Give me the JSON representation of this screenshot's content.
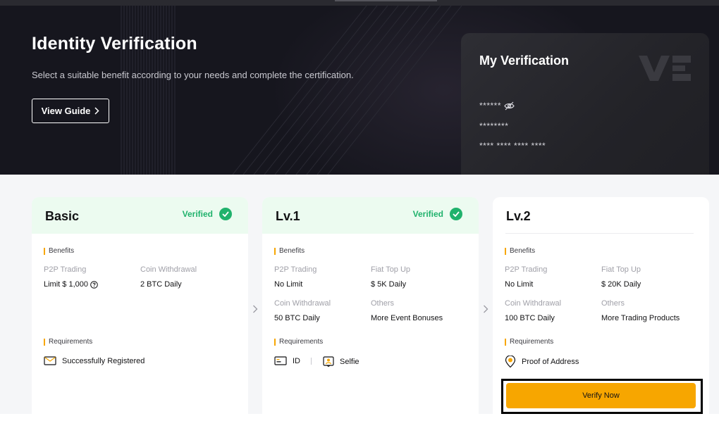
{
  "hero": {
    "title": "Identity Verification",
    "subtitle": "Select a suitable benefit according to your needs and complete the certification.",
    "guide_button": "View Guide"
  },
  "my_verification": {
    "title": "My Verification",
    "masked_name": "******",
    "masked_id": "********",
    "masked_number": "**** **** **** ****"
  },
  "cards": {
    "basic": {
      "level": "Basic",
      "status": "Verified",
      "benefits_label": "Benefits",
      "b1_key": "P2P Trading",
      "b1_val": "Limit $ 1,000",
      "b2_key": "Coin Withdrawal",
      "b2_val": "2 BTC Daily",
      "requirements_label": "Requirements",
      "req1": "Successfully Registered"
    },
    "lv1": {
      "level": "Lv.1",
      "status": "Verified",
      "benefits_label": "Benefits",
      "b1_key": "P2P Trading",
      "b1_val": "No Limit",
      "b2_key": "Fiat Top Up",
      "b2_val": "$ 5K Daily",
      "b3_key": "Coin Withdrawal",
      "b3_val": "50 BTC Daily",
      "b4_key": "Others",
      "b4_val": "More Event Bonuses",
      "requirements_label": "Requirements",
      "req1": "ID",
      "req2": "Selfie"
    },
    "lv2": {
      "level": "Lv.2",
      "benefits_label": "Benefits",
      "b1_key": "P2P Trading",
      "b1_val": "No Limit",
      "b2_key": "Fiat Top Up",
      "b2_val": "$ 20K Daily",
      "b3_key": "Coin Withdrawal",
      "b3_val": "100 BTC Daily",
      "b4_key": "Others",
      "b4_val": "More Trading Products",
      "requirements_label": "Requirements",
      "req1": "Proof of Address",
      "verify_button": "Verify Now"
    }
  },
  "colors": {
    "accent": "#f7a600",
    "verified": "#20b26c",
    "hero_bg": "#16161e"
  }
}
